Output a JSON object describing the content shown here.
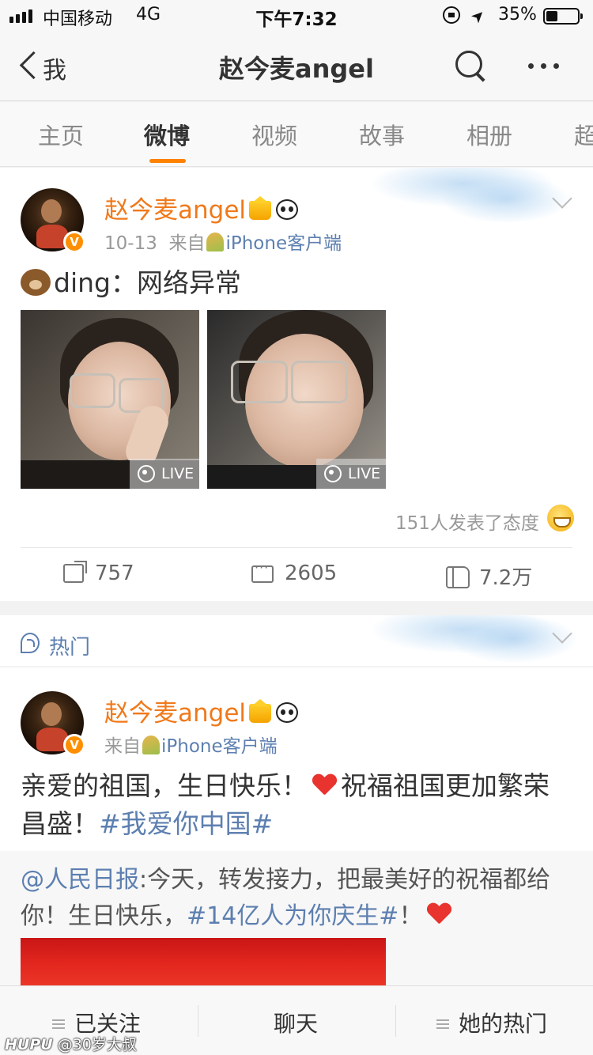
{
  "status_bar": {
    "carrier": "中国移动",
    "network": "4G",
    "time": "下午7:32",
    "battery": "35%"
  },
  "nav": {
    "back_label": "我",
    "title": "赵今麦angel"
  },
  "tabs": [
    {
      "label": "主页"
    },
    {
      "label": "微博"
    },
    {
      "label": "视频"
    },
    {
      "label": "故事"
    },
    {
      "label": "相册"
    },
    {
      "label": "超"
    }
  ],
  "active_tab": "微博",
  "accent_color": "#ff8200",
  "post1": {
    "author": "赵今麦angel",
    "date": "10-13",
    "source_prefix": "来自",
    "source": "iPhone客户端",
    "text": "ding：网络异常",
    "photos": [
      {
        "badge": "LIVE"
      },
      {
        "badge": "LIVE"
      }
    ],
    "attitude": "151人发表了态度",
    "reposts": "757",
    "comments": "2605",
    "likes": "7.2万"
  },
  "hot_section": {
    "label": "热门"
  },
  "post2": {
    "author": "赵今麦angel",
    "source_prefix": "来自",
    "source": "iPhone客户端",
    "text_a": "亲爱的祖国，生日快乐！",
    "text_b": "祝福祖国更加繁荣",
    "text_c": "昌盛！",
    "hashtag": "#我爱你中国#",
    "repost_mention": "@人民日报",
    "repost_text_a": ":今天，转发接力，把最美好的祝福都给你！生日快乐，",
    "repost_hashtag": "#14亿人为你庆生#",
    "repost_text_b": "！"
  },
  "bottom_bar": {
    "follow": "已关注",
    "chat": "聊天",
    "hot": "她的热门"
  },
  "watermark": {
    "brand": "HUPU",
    "user": "@30岁大叔"
  }
}
